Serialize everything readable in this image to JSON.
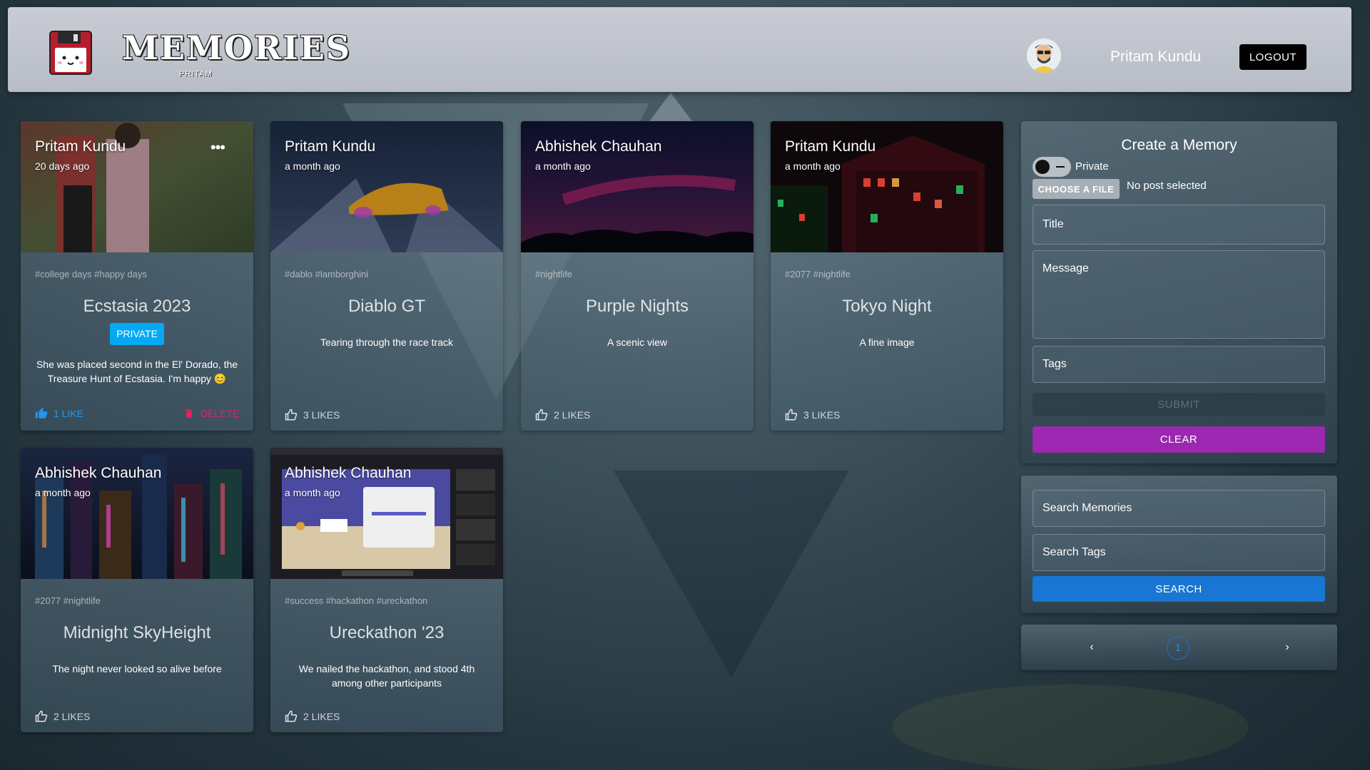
{
  "header": {
    "brand": "MEMORIES",
    "brand_sub": "PRITAM",
    "user_name": "Pritam Kundu",
    "logout_label": "LOGOUT"
  },
  "posts": [
    {
      "author": "Pritam Kundu",
      "time": "20 days ago",
      "tags": "#college days #happy days",
      "title": "Ecstasia 2023",
      "badge": "PRIVATE",
      "message": "She was placed second in the El' Dorado, the Treasure Hunt of Ecstasia. I'm happy 😊",
      "likes": "1 LIKE",
      "delete_label": "DELETE",
      "more": "•••"
    },
    {
      "author": "Pritam Kundu",
      "time": "a month ago",
      "tags": "#dablo #lamborghini",
      "title": "Diablo GT",
      "message": "Tearing through the race track",
      "likes": "3 LIKES"
    },
    {
      "author": "Abhishek Chauhan",
      "time": "a month ago",
      "tags": "#nightlife",
      "title": "Purple Nights",
      "message": "A scenic view",
      "likes": "2 LIKES"
    },
    {
      "author": "Pritam Kundu",
      "time": "a month ago",
      "tags": "#2077 #nightlife",
      "title": "Tokyo Night",
      "message": "A fine image",
      "likes": "3 LIKES"
    },
    {
      "author": "Abhishek Chauhan",
      "time": "a month ago",
      "tags": "#2077 #nightlife",
      "title": "Midnight SkyHeight",
      "message": "The night never looked so alive before",
      "likes": "2 LIKES"
    },
    {
      "author": "Abhishek Chauhan",
      "time": "a month ago",
      "tags": "#success #hackathon #ureckathon",
      "title": "Ureckathon '23",
      "message": "We nailed the hackathon, and stood 4th among other participants",
      "likes": "2 LIKES"
    }
  ],
  "form": {
    "title": "Create a Memory",
    "private_label": "Private",
    "choose_file_label": "CHOOSE A FILE",
    "file_status": "No post selected",
    "title_placeholder": "Title",
    "message_placeholder": "Message",
    "tags_placeholder": "Tags",
    "submit_label": "SUBMIT",
    "clear_label": "CLEAR"
  },
  "search": {
    "memories_placeholder": "Search Memories",
    "tags_placeholder": "Search Tags",
    "search_label": "SEARCH"
  },
  "pagination": {
    "prev": "‹",
    "current": "1",
    "next": "›"
  },
  "colors": {
    "accent_blue": "#1976d2",
    "clear_purple": "#9c27b0",
    "private_badge": "#03a9f4",
    "delete_pink": "#e91e63"
  }
}
